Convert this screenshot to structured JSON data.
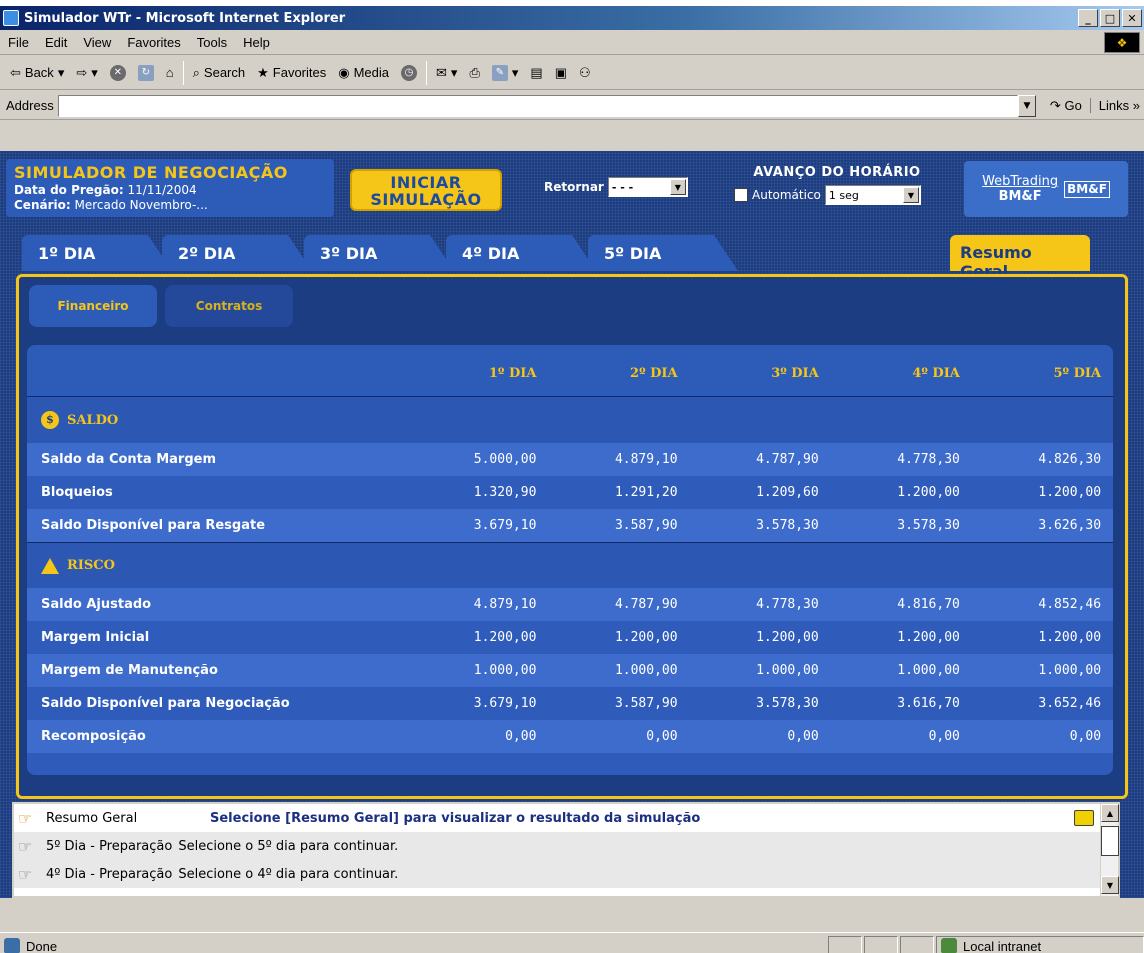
{
  "window": {
    "title": "Simulador WTr - Microsoft Internet Explorer"
  },
  "menu": [
    "File",
    "Edit",
    "View",
    "Favorites",
    "Tools",
    "Help"
  ],
  "toolbar": {
    "back": "Back",
    "search": "Search",
    "favorites": "Favorites",
    "media": "Media"
  },
  "address": {
    "label": "Address",
    "go": "Go",
    "links": "Links"
  },
  "simulator": {
    "title": "SIMULADOR DE NEGOCIAÇÃO",
    "date_label": "Data do Pregão:",
    "date_value": "11/11/2004",
    "scenario_label": "Cenário:",
    "scenario_value": "Mercado Novembro-...",
    "start_line1": "INICIAR",
    "start_line2": "SIMULAÇÃO",
    "retornar_label": "Retornar",
    "retornar_value": "- - -",
    "advance_title": "AVANÇO DO HORÁRIO",
    "auto_label": "Automático",
    "interval_value": "1 seg",
    "logo_web": "WebTrading",
    "logo_bmf": "BM&F",
    "logo_badge": "BM&F"
  },
  "tabs": [
    "1º DIA",
    "2º DIA",
    "3º DIA",
    "4º DIA",
    "5º DIA"
  ],
  "summary_tab": "Resumo Geral",
  "subtabs": {
    "financeiro": "Financeiro",
    "contratos": "Contratos"
  },
  "table": {
    "columns": [
      "1º DIA",
      "2º DIA",
      "3º DIA",
      "4º DIA",
      "5º DIA"
    ],
    "saldo_title": "SALDO",
    "saldo_rows": [
      {
        "label": "Saldo da Conta Margem",
        "values": [
          "5.000,00",
          "4.879,10",
          "4.787,90",
          "4.778,30",
          "4.826,30"
        ]
      },
      {
        "label": "Bloqueios",
        "values": [
          "1.320,90",
          "1.291,20",
          "1.209,60",
          "1.200,00",
          "1.200,00"
        ]
      },
      {
        "label": "Saldo Disponível para Resgate",
        "values": [
          "3.679,10",
          "3.587,90",
          "3.578,30",
          "3.578,30",
          "3.626,30"
        ]
      }
    ],
    "risco_title": "RISCO",
    "risco_rows": [
      {
        "label": "Saldo Ajustado",
        "values": [
          "4.879,10",
          "4.787,90",
          "4.778,30",
          "4.816,70",
          "4.852,46"
        ]
      },
      {
        "label": "Margem Inicial",
        "values": [
          "1.200,00",
          "1.200,00",
          "1.200,00",
          "1.200,00",
          "1.200,00"
        ]
      },
      {
        "label": "Margem de Manutenção",
        "values": [
          "1.000,00",
          "1.000,00",
          "1.000,00",
          "1.000,00",
          "1.000,00"
        ]
      },
      {
        "label": "Saldo Disponível para Negociação",
        "values": [
          "3.679,10",
          "3.587,90",
          "3.578,30",
          "3.616,70",
          "3.652,46"
        ]
      },
      {
        "label": "Recomposição",
        "values": [
          "0,00",
          "0,00",
          "0,00",
          "0,00",
          "0,00"
        ]
      }
    ]
  },
  "messages": [
    {
      "name": "Resumo Geral",
      "text": "Selecione [Resumo Geral] para visualizar o resultado da simulação"
    },
    {
      "name": "5º Dia - Preparação",
      "text": "Selecione o 5º dia para continuar."
    },
    {
      "name": "4º Dia - Preparação",
      "text": "Selecione o 4º dia para continuar."
    }
  ],
  "status": {
    "text": "Done",
    "zone": "Local intranet"
  }
}
